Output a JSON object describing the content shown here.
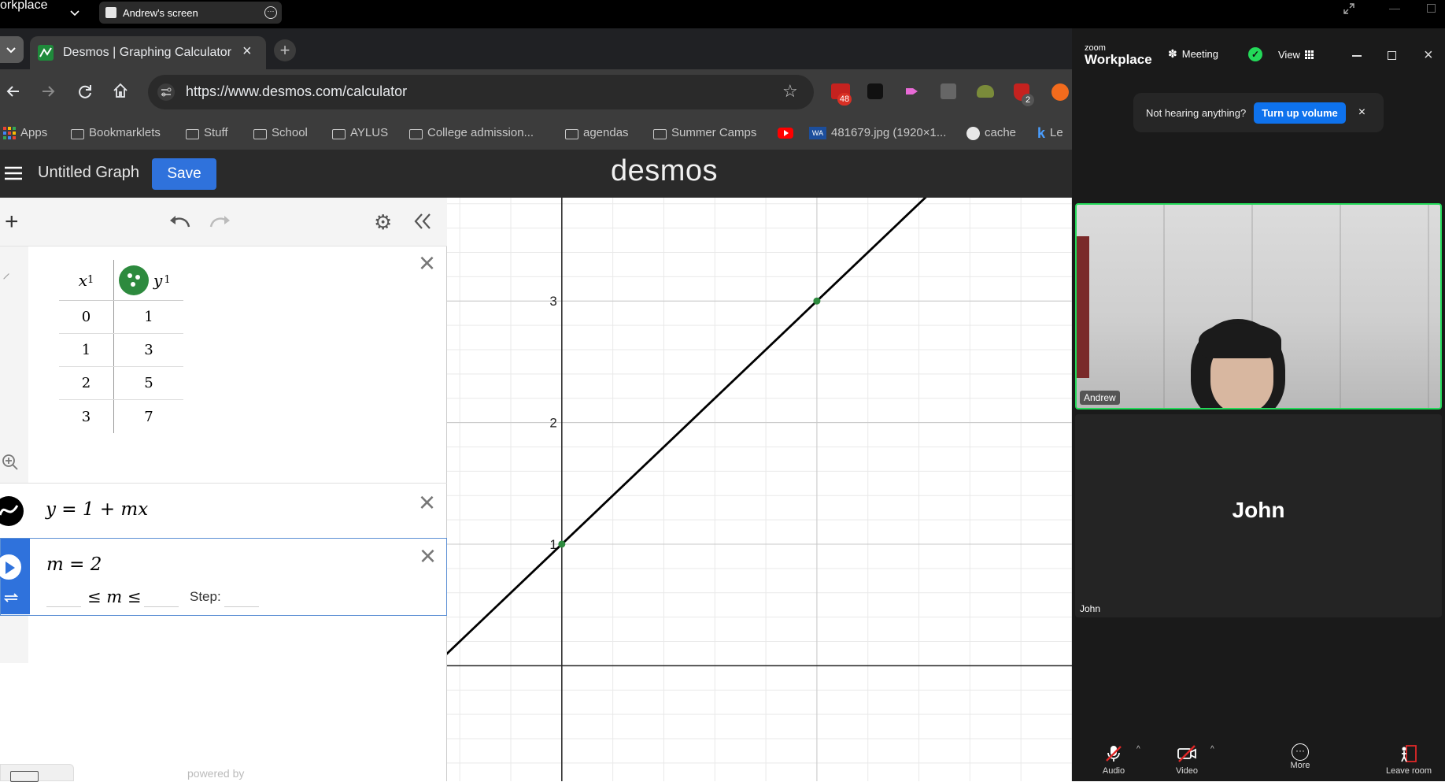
{
  "os_bar": {
    "brand": "orkplace",
    "share_tab_title": "Andrew's screen"
  },
  "browser": {
    "tab_title": "Desmos | Graphing Calculator",
    "url": "https://www.desmos.com/calculator",
    "bookmarks": [
      {
        "label": "Apps",
        "icon": "apps-grid-icon"
      },
      {
        "label": "Bookmarklets",
        "icon": "folder-icon"
      },
      {
        "label": "Stuff",
        "icon": "folder-icon"
      },
      {
        "label": "School",
        "icon": "folder-icon"
      },
      {
        "label": "AYLUS",
        "icon": "folder-icon"
      },
      {
        "label": "College admission...",
        "icon": "folder-icon"
      },
      {
        "label": "agendas",
        "icon": "folder-icon"
      },
      {
        "label": "Summer Camps",
        "icon": "folder-icon"
      },
      {
        "label": "",
        "icon": "youtube-icon"
      },
      {
        "label": "481679.jpg (1920×1...",
        "icon": "wolfram-icon"
      },
      {
        "label": "cache",
        "icon": "globe-icon"
      },
      {
        "label": "Le",
        "icon": "k-icon"
      }
    ],
    "extension_badges": [
      "48",
      "2"
    ]
  },
  "desmos": {
    "graph_title": "Untitled Graph",
    "save_label": "Save",
    "logo": "desmos",
    "table": {
      "headers": [
        "x",
        "y"
      ],
      "header_sub": "1",
      "rows": [
        [
          "0",
          "1"
        ],
        [
          "1",
          "3"
        ],
        [
          "2",
          "5"
        ],
        [
          "3",
          "7"
        ]
      ]
    },
    "expression": "y = 1 + mx",
    "slider_expression": "m = 2",
    "slider_range": "≤ m ≤",
    "step_label": "Step:",
    "powered_by": "powered by"
  },
  "chart_data": {
    "type": "line",
    "x_ticks": [],
    "y_ticks": [
      "1",
      "2",
      "3"
    ],
    "xlim": [
      -0.45,
      2.0
    ],
    "ylim": [
      -0.95,
      3.85
    ],
    "grid": true,
    "series": [
      {
        "equation": "y = 1 + 2x",
        "x": [
          -0.5,
          1.5
        ],
        "y": [
          0,
          4
        ],
        "color": "#000000"
      }
    ],
    "points": {
      "x": [
        0,
        1,
        2,
        3
      ],
      "y": [
        1,
        3,
        5,
        7
      ],
      "color": "#2d8a3e"
    }
  },
  "zoom": {
    "brand_top": "zoom",
    "brand": "Workplace",
    "meeting_label": "Meeting",
    "view_label": "View",
    "notice_text": "Not hearing anything?",
    "notice_button": "Turn up volume",
    "participants": [
      {
        "name": "Andrew"
      },
      {
        "name": "John",
        "display": "John"
      }
    ],
    "controls": [
      "Audio",
      "Video",
      "More",
      "Leave room"
    ],
    "accent_green": "#23d959",
    "accent_blue": "#0e72ed",
    "danger_red": "#e02828"
  }
}
